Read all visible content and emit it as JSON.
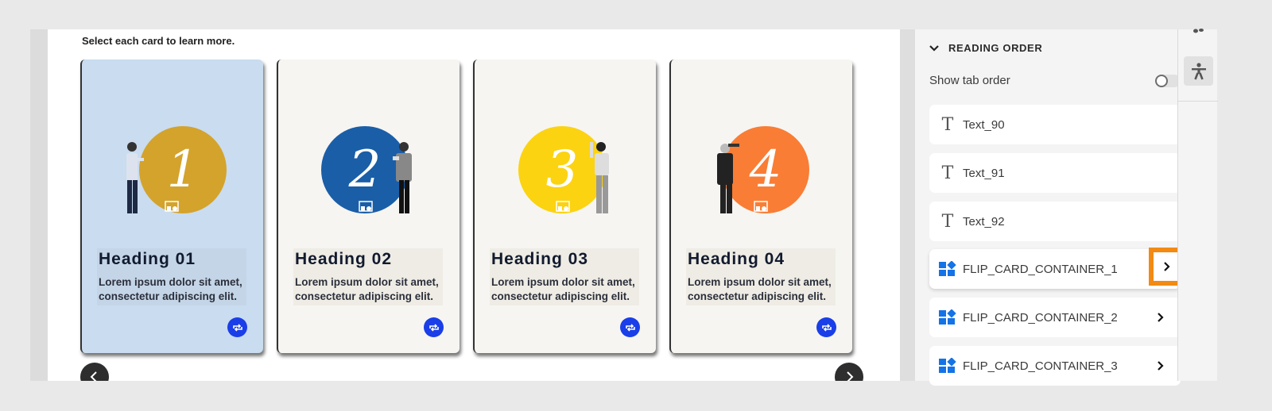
{
  "canvas": {
    "instruction": "Select each card to learn more.",
    "cards": [
      {
        "number": "1",
        "heading": "Heading 01",
        "body": "Lorem ipsum dolor sit amet, consectetur adipiscing elit.",
        "bg": "#c9dcf0",
        "circle": "#d4a32c",
        "textbg": "#c4d5e8",
        "selected": true
      },
      {
        "number": "2",
        "heading": "Heading 02",
        "body": "Lorem ipsum dolor sit amet, consectetur adipiscing elit.",
        "bg": "#f6f5f2",
        "circle": "#1a5ea8",
        "textbg": "#efece5",
        "selected": false
      },
      {
        "number": "3",
        "heading": "Heading 03",
        "body": "Lorem ipsum dolor sit amet, consectetur adipiscing elit.",
        "bg": "#f6f5f2",
        "circle": "#fbd311",
        "textbg": "#efece5",
        "selected": false
      },
      {
        "number": "4",
        "heading": "Heading 04",
        "body": "Lorem ipsum dolor sit amet, consectetur adipiscing elit.",
        "bg": "#f6f5f2",
        "circle": "#f97d35",
        "textbg": "#efece5",
        "selected": false
      }
    ],
    "flip_icon": "flip-icon",
    "nav": {
      "prev_icon": "chevron-left-icon",
      "next_icon": "chevron-right-icon"
    }
  },
  "panel": {
    "section_title": "READING ORDER",
    "toggle_label": "Show tab order",
    "toggle_on": false,
    "items": [
      {
        "type": "text",
        "icon": "text-icon",
        "label": "Text_90",
        "has_chevron": false
      },
      {
        "type": "text",
        "icon": "text-icon",
        "label": "Text_91",
        "has_chevron": false
      },
      {
        "type": "text",
        "icon": "text-icon",
        "label": "Text_92",
        "has_chevron": false
      },
      {
        "type": "container",
        "icon": "container-icon",
        "label": "FLIP_CARD_CONTAINER_1",
        "has_chevron": true,
        "highlighted": true
      },
      {
        "type": "container",
        "icon": "container-icon",
        "label": "FLIP_CARD_CONTAINER_2",
        "has_chevron": true
      },
      {
        "type": "container",
        "icon": "container-icon",
        "label": "FLIP_CARD_CONTAINER_3",
        "has_chevron": true
      }
    ]
  },
  "rail": {
    "accessibility_icon": "accessibility-icon"
  },
  "colors": {
    "highlight": "#f28a13",
    "accent_blue": "#1a3ee8",
    "container_icon": "#1473e6"
  }
}
